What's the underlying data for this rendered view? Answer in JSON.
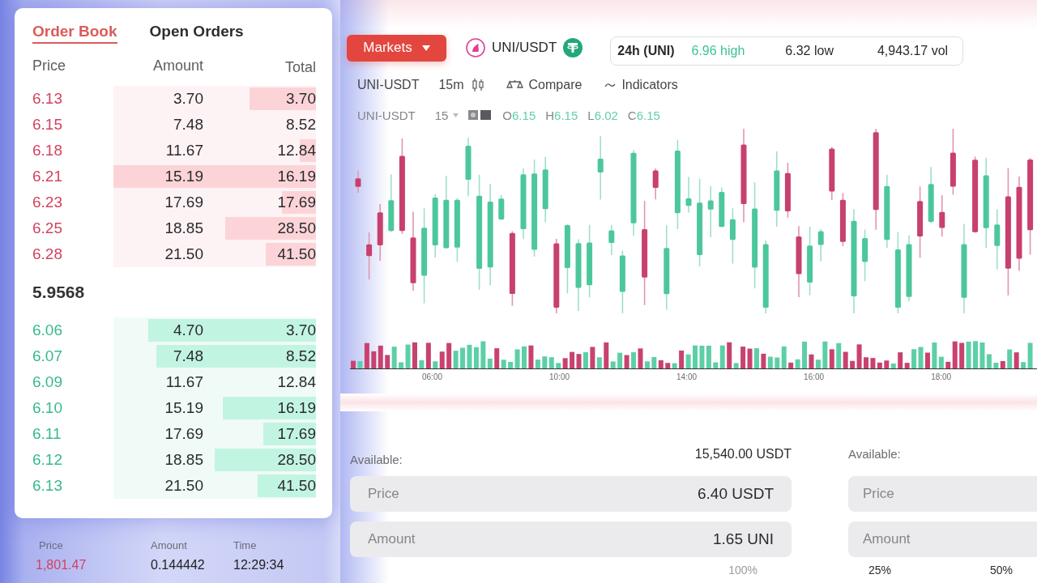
{
  "order_book": {
    "tabs": [
      {
        "label": "Order Book",
        "selected": true
      },
      {
        "label": "Open Orders",
        "selected": false
      }
    ],
    "columns": [
      "Price",
      "Amount",
      "Total"
    ],
    "asks": [
      {
        "price": "6.13",
        "amount": "3.70",
        "total": "3.70",
        "level": 0.33
      },
      {
        "price": "6.15",
        "amount": "7.48",
        "total": "8.52"
      },
      {
        "price": "6.18",
        "amount": "11.67",
        "total": "12.84",
        "level": 0.08
      },
      {
        "price": "6.21",
        "amount": "15.19",
        "total": "16.19",
        "level": 1
      },
      {
        "price": "6.23",
        "amount": "17.69",
        "total": "17.69",
        "level": 0.17
      },
      {
        "price": "6.25",
        "amount": "18.85",
        "total": "28.50",
        "level": 0.45
      },
      {
        "price": "6.28",
        "amount": "21.50",
        "total": "41.50",
        "level": 0.25
      }
    ],
    "last_price": "5.9568",
    "bids": [
      {
        "price": "6.06",
        "amount": "4.70",
        "total": "3.70",
        "level": 0.83
      },
      {
        "price": "6.07",
        "amount": "7.48",
        "total": "8.52",
        "level": 0.79
      },
      {
        "price": "6.09",
        "amount": "11.67",
        "total": "12.84"
      },
      {
        "price": "6.10",
        "amount": "15.19",
        "total": "16.19",
        "level": 0.46
      },
      {
        "price": "6.11",
        "amount": "17.69",
        "total": "17.69",
        "level": 0.26
      },
      {
        "price": "6.12",
        "amount": "18.85",
        "total": "28.50",
        "level": 0.5
      },
      {
        "price": "6.13",
        "amount": "21.50",
        "total": "41.50",
        "level": 0.29
      }
    ]
  },
  "trades": {
    "columns": [
      "Price",
      "Amount",
      "Time"
    ],
    "rows": [
      {
        "price": "1,801.47",
        "amount": "0.144442",
        "time": "12:29:34"
      }
    ]
  },
  "header": {
    "markets_button": "Markets",
    "pair": "UNI/USDT",
    "stats": {
      "label": "24h (UNI)",
      "high": "6.96 high",
      "low": "6.32 low",
      "volume": "4,943.17 vol"
    }
  },
  "toolbar": {
    "symbol": "UNI-USDT",
    "interval": "15m",
    "items": [
      {
        "label": "Compare",
        "kind": "compare"
      },
      {
        "label": "Indicators",
        "kind": "indicators"
      }
    ]
  },
  "legend": {
    "symbol": "UNI-USDT",
    "interval": "15",
    "values": [
      {
        "label": "O",
        "value": "6.15"
      },
      {
        "label": "H",
        "value": "6.15"
      },
      {
        "label": "L",
        "value": "6.02"
      },
      {
        "label": "C",
        "value": "6.15"
      }
    ]
  },
  "chart": {
    "x_labels": [
      "06:00",
      "10:00",
      "14:00",
      "16:00",
      "18:00"
    ]
  },
  "order_forms": [
    {
      "available_label": "Available:",
      "available": "15,540.00 USDT",
      "fields": [
        {
          "label": "Price",
          "value": "6.40 USDT"
        },
        {
          "label": "Amount",
          "value": "1.65 UNI"
        }
      ],
      "percents": [
        "100%"
      ]
    },
    {
      "available_label": "Available:",
      "fields": [
        {
          "label": "Price"
        },
        {
          "label": "Amount"
        }
      ],
      "percents": [
        "25%",
        "50%"
      ]
    }
  ]
}
